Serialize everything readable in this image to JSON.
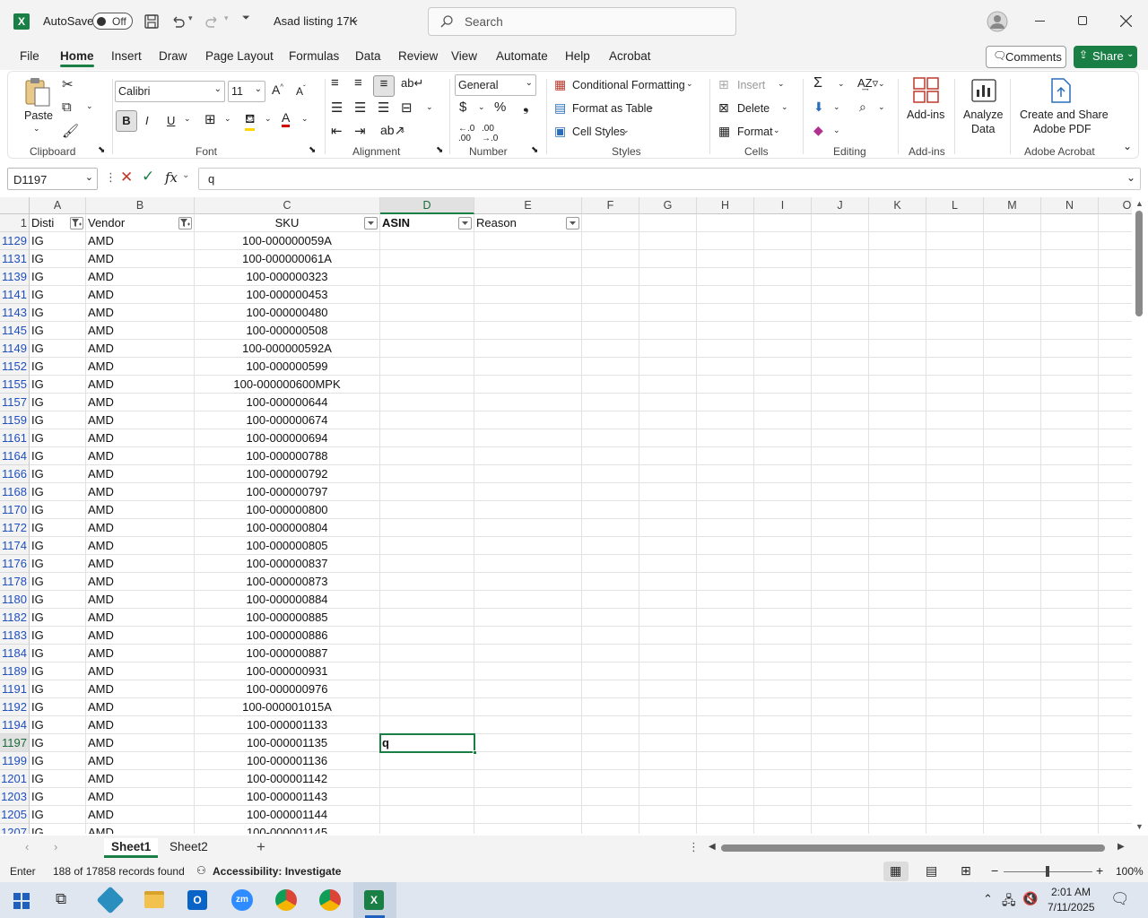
{
  "titlebar": {
    "autosave_label": "AutoSave",
    "autosave_state": "Off",
    "file_title": "Asad listing 17K",
    "search_placeholder": "Search"
  },
  "menu": {
    "tabs": [
      "File",
      "Home",
      "Insert",
      "Draw",
      "Page Layout",
      "Formulas",
      "Data",
      "Review",
      "View",
      "Automate",
      "Help",
      "Acrobat"
    ],
    "active": "Home",
    "comments_label": "Comments",
    "share_label": "Share"
  },
  "ribbon": {
    "clipboard": {
      "paste": "Paste",
      "label": "Clipboard"
    },
    "font": {
      "family": "Calibri",
      "size": "11",
      "label": "Font"
    },
    "alignment": {
      "label": "Alignment"
    },
    "number": {
      "format": "General",
      "label": "Number"
    },
    "styles": {
      "conditional": "Conditional Formatting",
      "table": "Format as Table",
      "cell": "Cell Styles",
      "label": "Styles"
    },
    "cells": {
      "insert": "Insert",
      "delete": "Delete",
      "format": "Format",
      "label": "Cells"
    },
    "editing": {
      "label": "Editing"
    },
    "addins": {
      "button": "Add-ins",
      "label": "Add-ins"
    },
    "analyze": {
      "line1": "Analyze",
      "line2": "Data"
    },
    "acrobat": {
      "line1": "Create and Share",
      "line2": "Adobe PDF",
      "label": "Adobe Acrobat"
    }
  },
  "formula_bar": {
    "name_box": "D1197",
    "fx": "fx",
    "content": "q"
  },
  "grid": {
    "columns": [
      "A",
      "B",
      "C",
      "D",
      "E",
      "F",
      "G",
      "H",
      "I",
      "J",
      "K",
      "L",
      "M",
      "N",
      "O"
    ],
    "selected_column": "D",
    "header_row": {
      "row": "1",
      "cells": [
        "Disti",
        "Vendor",
        "SKU",
        "ASIN",
        "Reason"
      ]
    },
    "rows": [
      {
        "n": "1129",
        "a": "IG",
        "b": "AMD",
        "c": "100-000000059A"
      },
      {
        "n": "1131",
        "a": "IG",
        "b": "AMD",
        "c": "100-000000061A"
      },
      {
        "n": "1139",
        "a": "IG",
        "b": "AMD",
        "c": "100-000000323"
      },
      {
        "n": "1141",
        "a": "IG",
        "b": "AMD",
        "c": "100-000000453"
      },
      {
        "n": "1143",
        "a": "IG",
        "b": "AMD",
        "c": "100-000000480"
      },
      {
        "n": "1145",
        "a": "IG",
        "b": "AMD",
        "c": "100-000000508"
      },
      {
        "n": "1149",
        "a": "IG",
        "b": "AMD",
        "c": "100-000000592A"
      },
      {
        "n": "1152",
        "a": "IG",
        "b": "AMD",
        "c": "100-000000599"
      },
      {
        "n": "1155",
        "a": "IG",
        "b": "AMD",
        "c": "100-000000600MPK"
      },
      {
        "n": "1157",
        "a": "IG",
        "b": "AMD",
        "c": "100-000000644"
      },
      {
        "n": "1159",
        "a": "IG",
        "b": "AMD",
        "c": "100-000000674"
      },
      {
        "n": "1161",
        "a": "IG",
        "b": "AMD",
        "c": "100-000000694"
      },
      {
        "n": "1164",
        "a": "IG",
        "b": "AMD",
        "c": "100-000000788"
      },
      {
        "n": "1166",
        "a": "IG",
        "b": "AMD",
        "c": "100-000000792"
      },
      {
        "n": "1168",
        "a": "IG",
        "b": "AMD",
        "c": "100-000000797"
      },
      {
        "n": "1170",
        "a": "IG",
        "b": "AMD",
        "c": "100-000000800"
      },
      {
        "n": "1172",
        "a": "IG",
        "b": "AMD",
        "c": "100-000000804"
      },
      {
        "n": "1174",
        "a": "IG",
        "b": "AMD",
        "c": "100-000000805"
      },
      {
        "n": "1176",
        "a": "IG",
        "b": "AMD",
        "c": "100-000000837"
      },
      {
        "n": "1178",
        "a": "IG",
        "b": "AMD",
        "c": "100-000000873"
      },
      {
        "n": "1180",
        "a": "IG",
        "b": "AMD",
        "c": "100-000000884"
      },
      {
        "n": "1182",
        "a": "IG",
        "b": "AMD",
        "c": "100-000000885"
      },
      {
        "n": "1183",
        "a": "IG",
        "b": "AMD",
        "c": "100-000000886"
      },
      {
        "n": "1184",
        "a": "IG",
        "b": "AMD",
        "c": "100-000000887"
      },
      {
        "n": "1189",
        "a": "IG",
        "b": "AMD",
        "c": "100-000000931"
      },
      {
        "n": "1191",
        "a": "IG",
        "b": "AMD",
        "c": "100-000000976"
      },
      {
        "n": "1192",
        "a": "IG",
        "b": "AMD",
        "c": "100-000001015A"
      },
      {
        "n": "1194",
        "a": "IG",
        "b": "AMD",
        "c": "100-000001133"
      },
      {
        "n": "1197",
        "a": "IG",
        "b": "AMD",
        "c": "100-000001135",
        "d": "q"
      },
      {
        "n": "1199",
        "a": "IG",
        "b": "AMD",
        "c": "100-000001136"
      },
      {
        "n": "1201",
        "a": "IG",
        "b": "AMD",
        "c": "100-000001142"
      },
      {
        "n": "1203",
        "a": "IG",
        "b": "AMD",
        "c": "100-000001143"
      },
      {
        "n": "1205",
        "a": "IG",
        "b": "AMD",
        "c": "100-000001144"
      },
      {
        "n": "1207",
        "a": "IG",
        "b": "AMD",
        "c": "100-000001145"
      }
    ],
    "active_row": "1197"
  },
  "sheets": {
    "tabs": [
      "Sheet1",
      "Sheet2"
    ],
    "active": "Sheet1"
  },
  "status": {
    "mode": "Enter",
    "records": "188 of 17858 records found",
    "accessibility": "Accessibility: Investigate",
    "zoom": "100%"
  },
  "taskbar": {
    "time": "2:01 AM",
    "date": "7/11/2025"
  },
  "colors": {
    "accent": "#1a7f45",
    "share_bg": "#1a7f45",
    "row_number": "#1f4fbf"
  }
}
